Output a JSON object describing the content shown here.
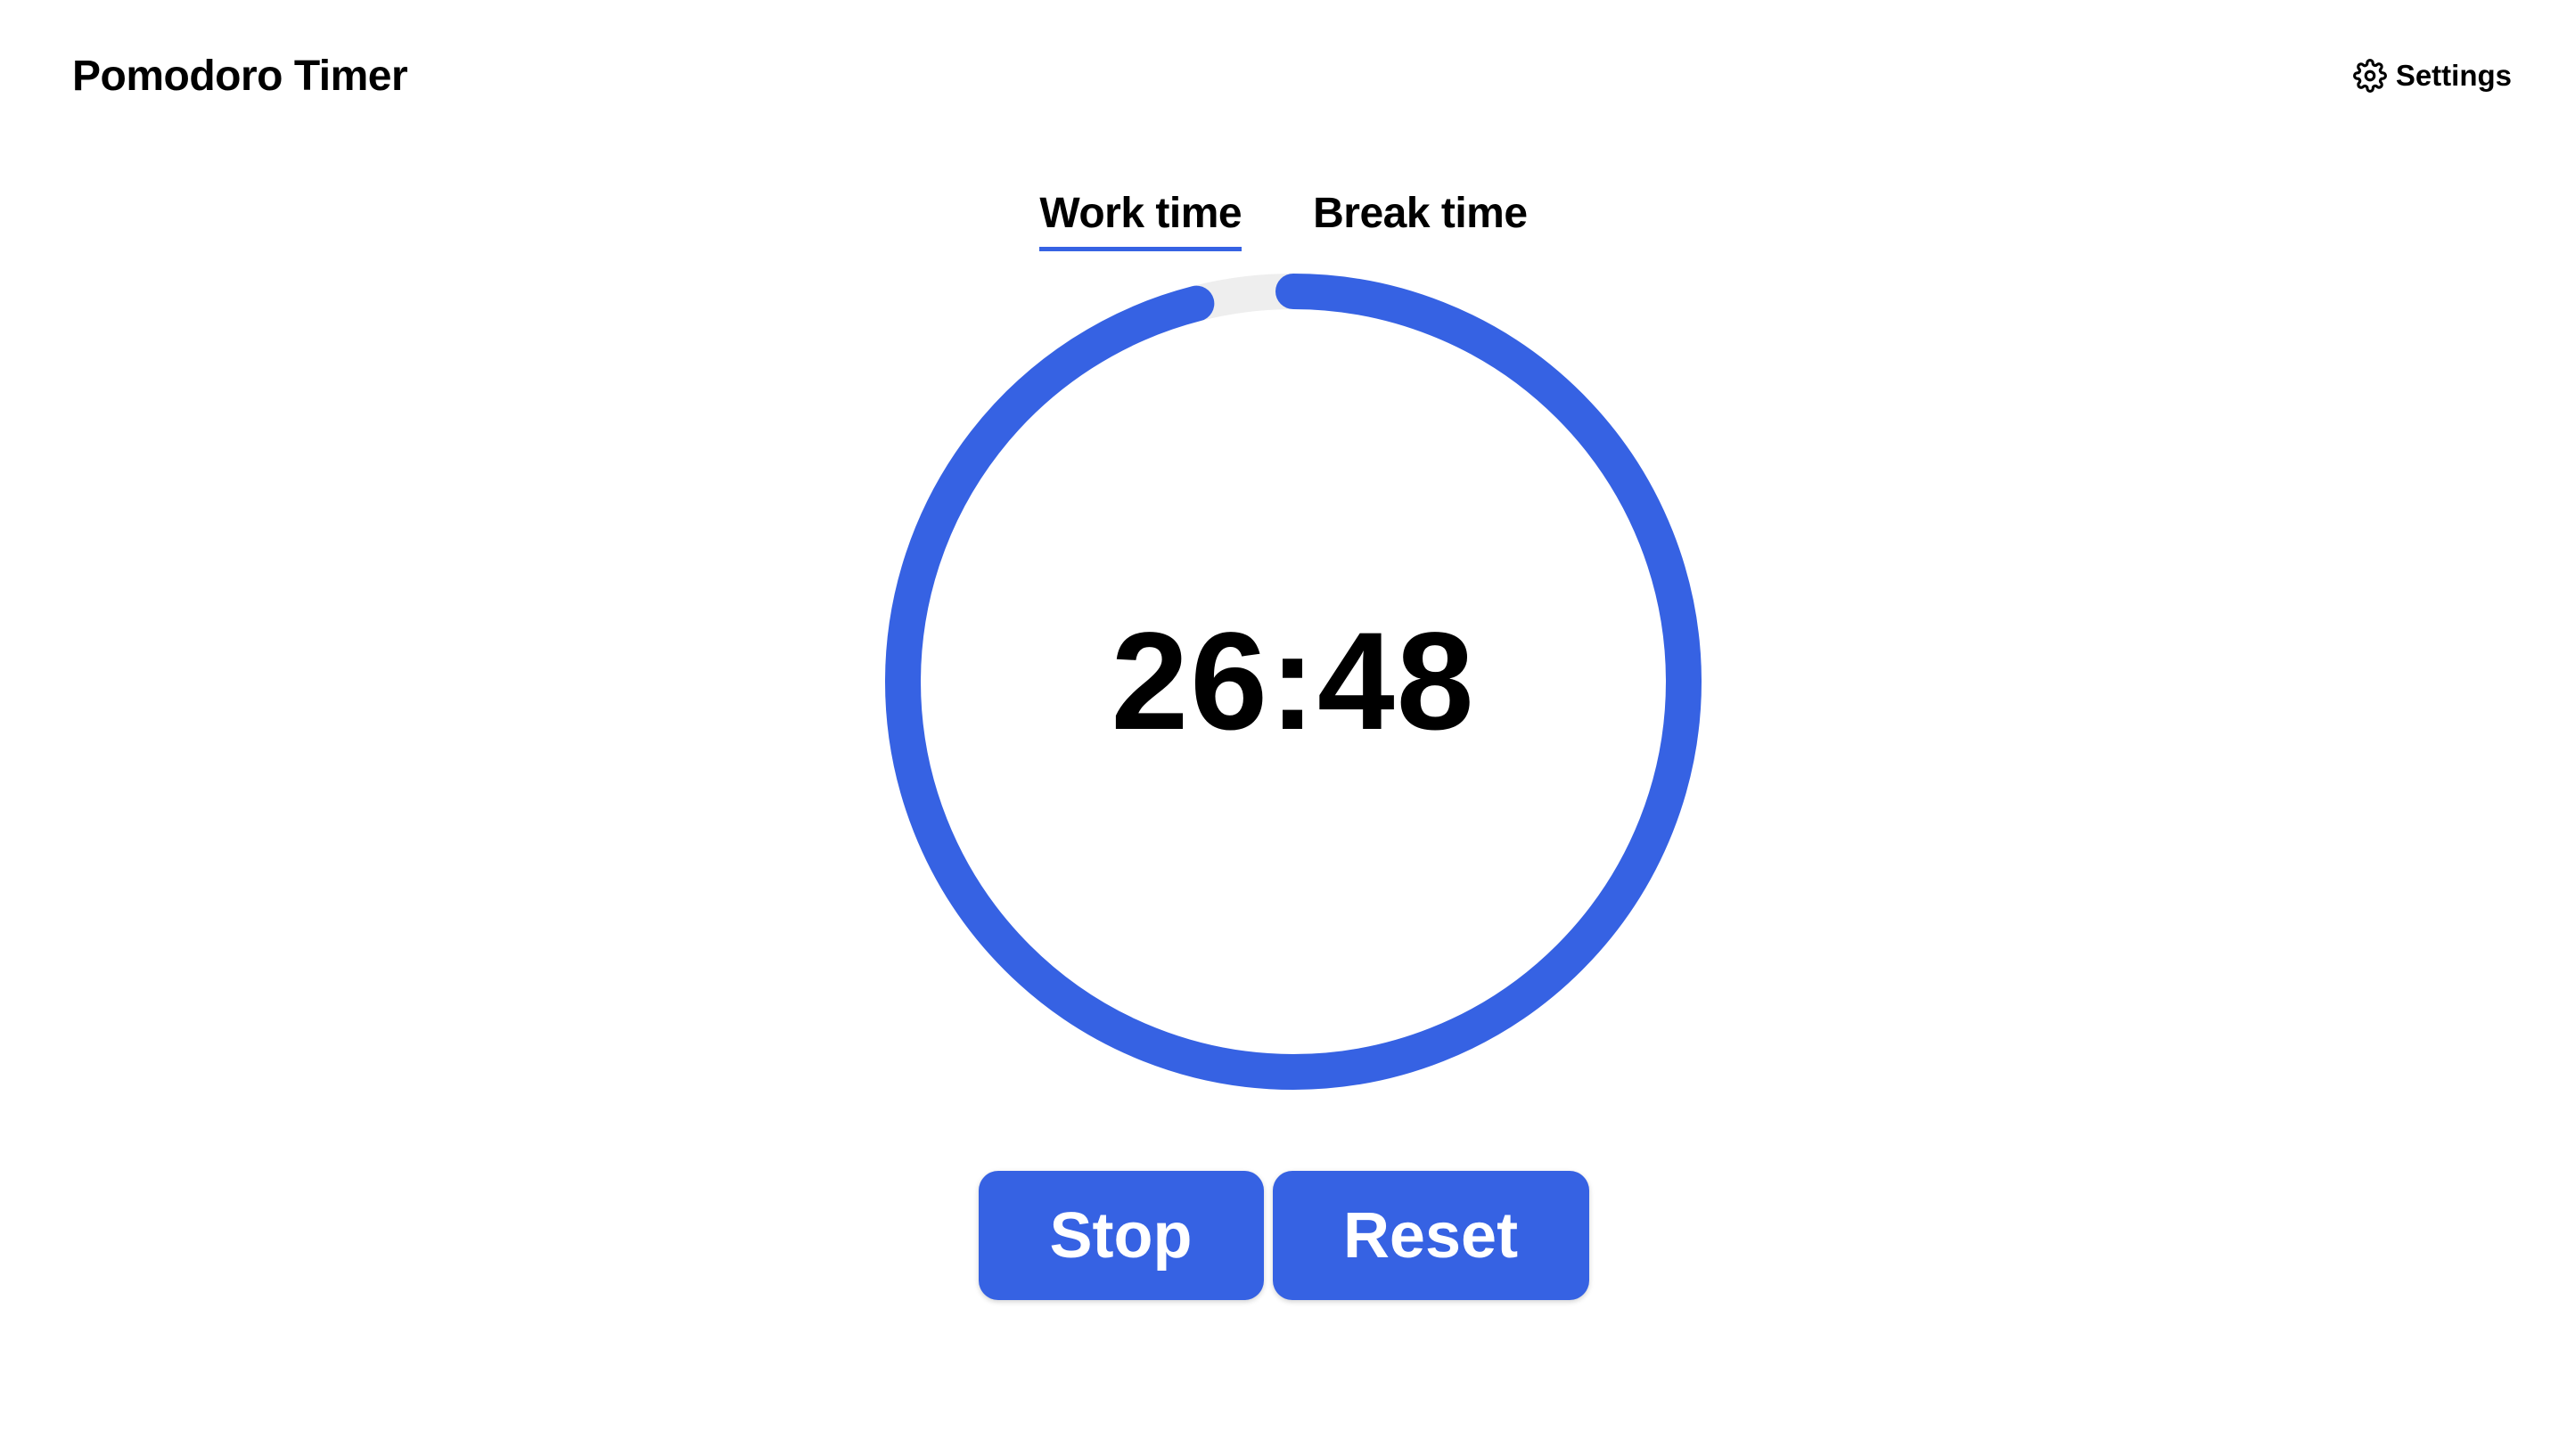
{
  "app": {
    "title": "Pomodoro Timer"
  },
  "header": {
    "settings_label": "Settings",
    "settings_icon": "gear-icon"
  },
  "tabs": [
    {
      "label": "Work time",
      "active": true
    },
    {
      "label": "Break time",
      "active": false
    }
  ],
  "timer": {
    "display": "26:48",
    "progress_fraction": 0.96
  },
  "controls": {
    "stop_label": "Stop",
    "reset_label": "Reset"
  },
  "colors": {
    "accent": "#3662e3",
    "track": "#eeeeee",
    "text": "#000000",
    "background": "#ffffff"
  }
}
